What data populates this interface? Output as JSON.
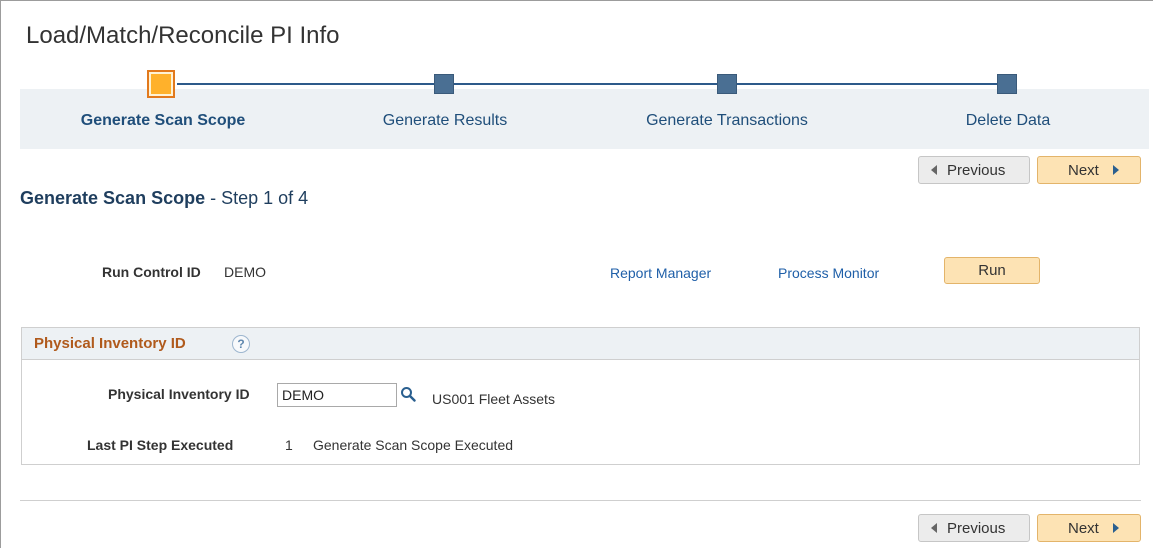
{
  "page": {
    "title": "Load/Match/Reconcile PI Info"
  },
  "train": {
    "steps": [
      {
        "label": "Generate Scan Scope",
        "state": "active"
      },
      {
        "label": "Generate Results",
        "state": "pending"
      },
      {
        "label": "Generate Transactions",
        "state": "pending"
      },
      {
        "label": "Delete Data",
        "state": "pending"
      }
    ]
  },
  "nav": {
    "previous_label": "Previous",
    "next_label": "Next"
  },
  "step": {
    "title": "Generate Scan Scope",
    "suffix": " - Step 1 of 4"
  },
  "run_control": {
    "label": "Run Control ID",
    "value": "DEMO",
    "report_manager_label": "Report Manager",
    "process_monitor_label": "Process Monitor",
    "run_label": "Run"
  },
  "pi_group": {
    "title": "Physical Inventory ID",
    "help_icon": "?",
    "pi_id_label": "Physical Inventory ID",
    "pi_id_value": "DEMO",
    "pi_description": "US001 Fleet Assets",
    "last_step_label": "Last PI Step Executed",
    "last_step_number": "1",
    "last_step_description": "Generate Scan Scope Executed"
  },
  "colors": {
    "accent_active": "#ffb12b",
    "train_node": "#4a6f93",
    "link": "#1f5fa8",
    "group_title": "#b05a1c",
    "primary_button": "#fde3b4"
  }
}
